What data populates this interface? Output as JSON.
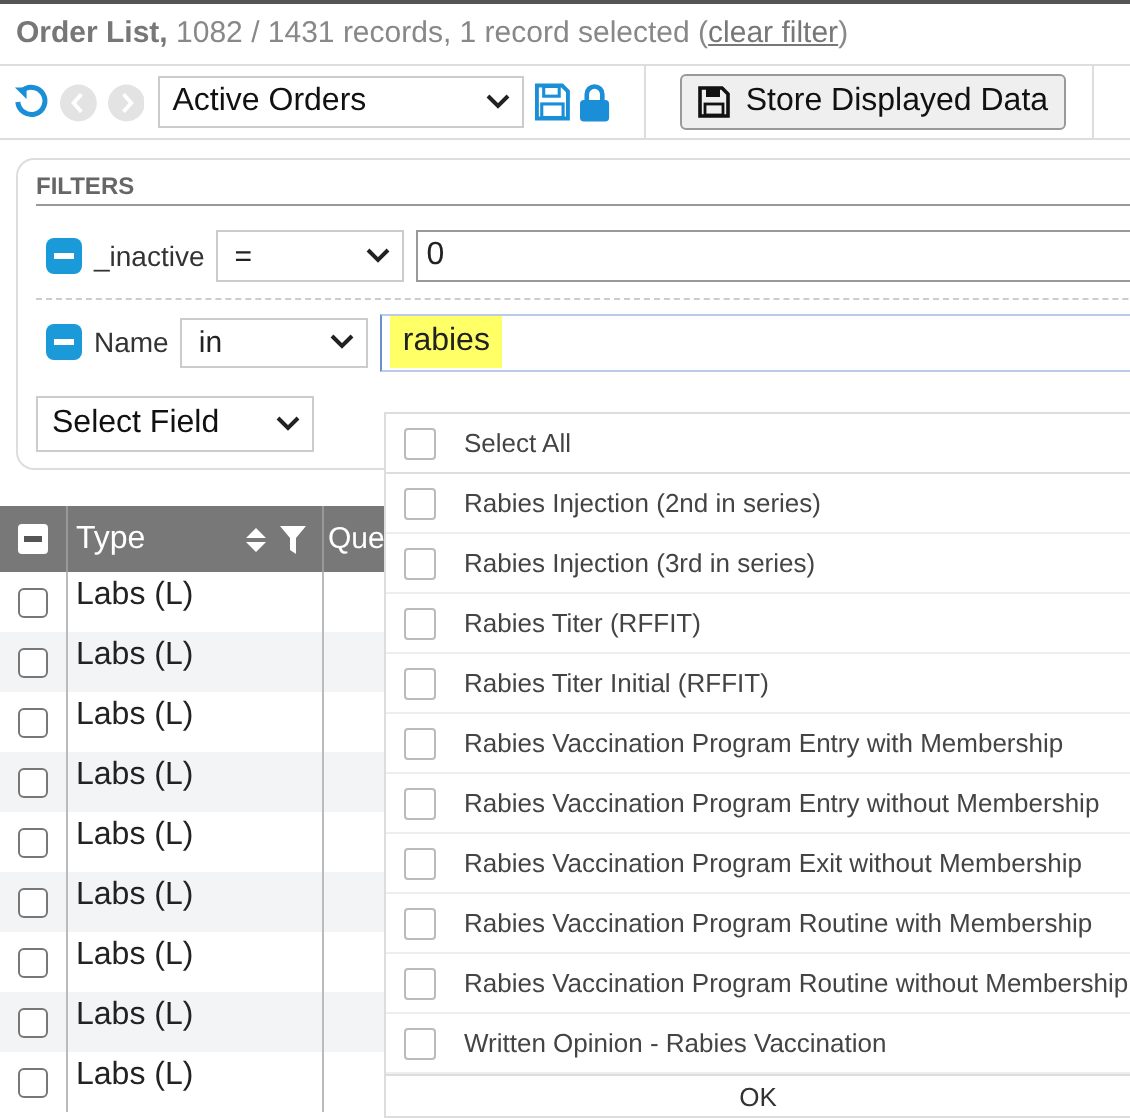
{
  "title": {
    "heading": "Order List,",
    "summary": "1082 / 1431 records, 1 record selected (",
    "link": "clear filter",
    "close": ")"
  },
  "toolbar": {
    "back": {
      "disabled": true
    },
    "forward": {
      "disabled": true
    },
    "view": "Active Orders",
    "store_button": "Store Displayed Data"
  },
  "filters": {
    "title": "FILTERS",
    "rows": [
      {
        "field": "_inactive",
        "operator": "=",
        "value": "0",
        "focused": false,
        "highlighted": false
      },
      {
        "field": "Name",
        "operator": "in",
        "value": "rabies",
        "focused": true,
        "highlighted": true
      }
    ],
    "add_field": "Select Field"
  },
  "table": {
    "header_checkbox": {
      "indeterminate": true
    },
    "columns": [
      "Type",
      "Que"
    ],
    "rows": [
      {
        "type": "Labs (L)",
        "checked": false
      },
      {
        "type": "Labs (L)",
        "checked": false
      },
      {
        "type": "Labs (L)",
        "checked": false
      },
      {
        "type": "Labs (L)",
        "checked": false
      },
      {
        "type": "Labs (L)",
        "checked": false
      },
      {
        "type": "Labs (L)",
        "checked": false
      },
      {
        "type": "Labs (L)",
        "checked": false
      },
      {
        "type": "Labs (L)",
        "checked": false
      },
      {
        "type": "Labs (L)",
        "checked": false
      }
    ]
  },
  "picker": {
    "select_all": {
      "label": "Select All",
      "checked": false
    },
    "options": [
      {
        "label": "Rabies Injection (2nd in series)",
        "checked": false
      },
      {
        "label": "Rabies Injection (3rd in series)",
        "checked": false
      },
      {
        "label": "Rabies Titer (RFFIT)",
        "checked": false
      },
      {
        "label": "Rabies Titer Initial (RFFIT)",
        "checked": false
      },
      {
        "label": "Rabies Vaccination Program Entry with Membership",
        "checked": false
      },
      {
        "label": "Rabies Vaccination Program Entry without Membership",
        "checked": false
      },
      {
        "label": "Rabies Vaccination Program Exit without Membership",
        "checked": false
      },
      {
        "label": "Rabies Vaccination Program Routine with Membership",
        "checked": false
      },
      {
        "label": "Rabies Vaccination Program Routine without Membership",
        "checked": false
      },
      {
        "label": "Written Opinion - Rabies Vaccination",
        "checked": false
      }
    ],
    "ok": "OK"
  }
}
